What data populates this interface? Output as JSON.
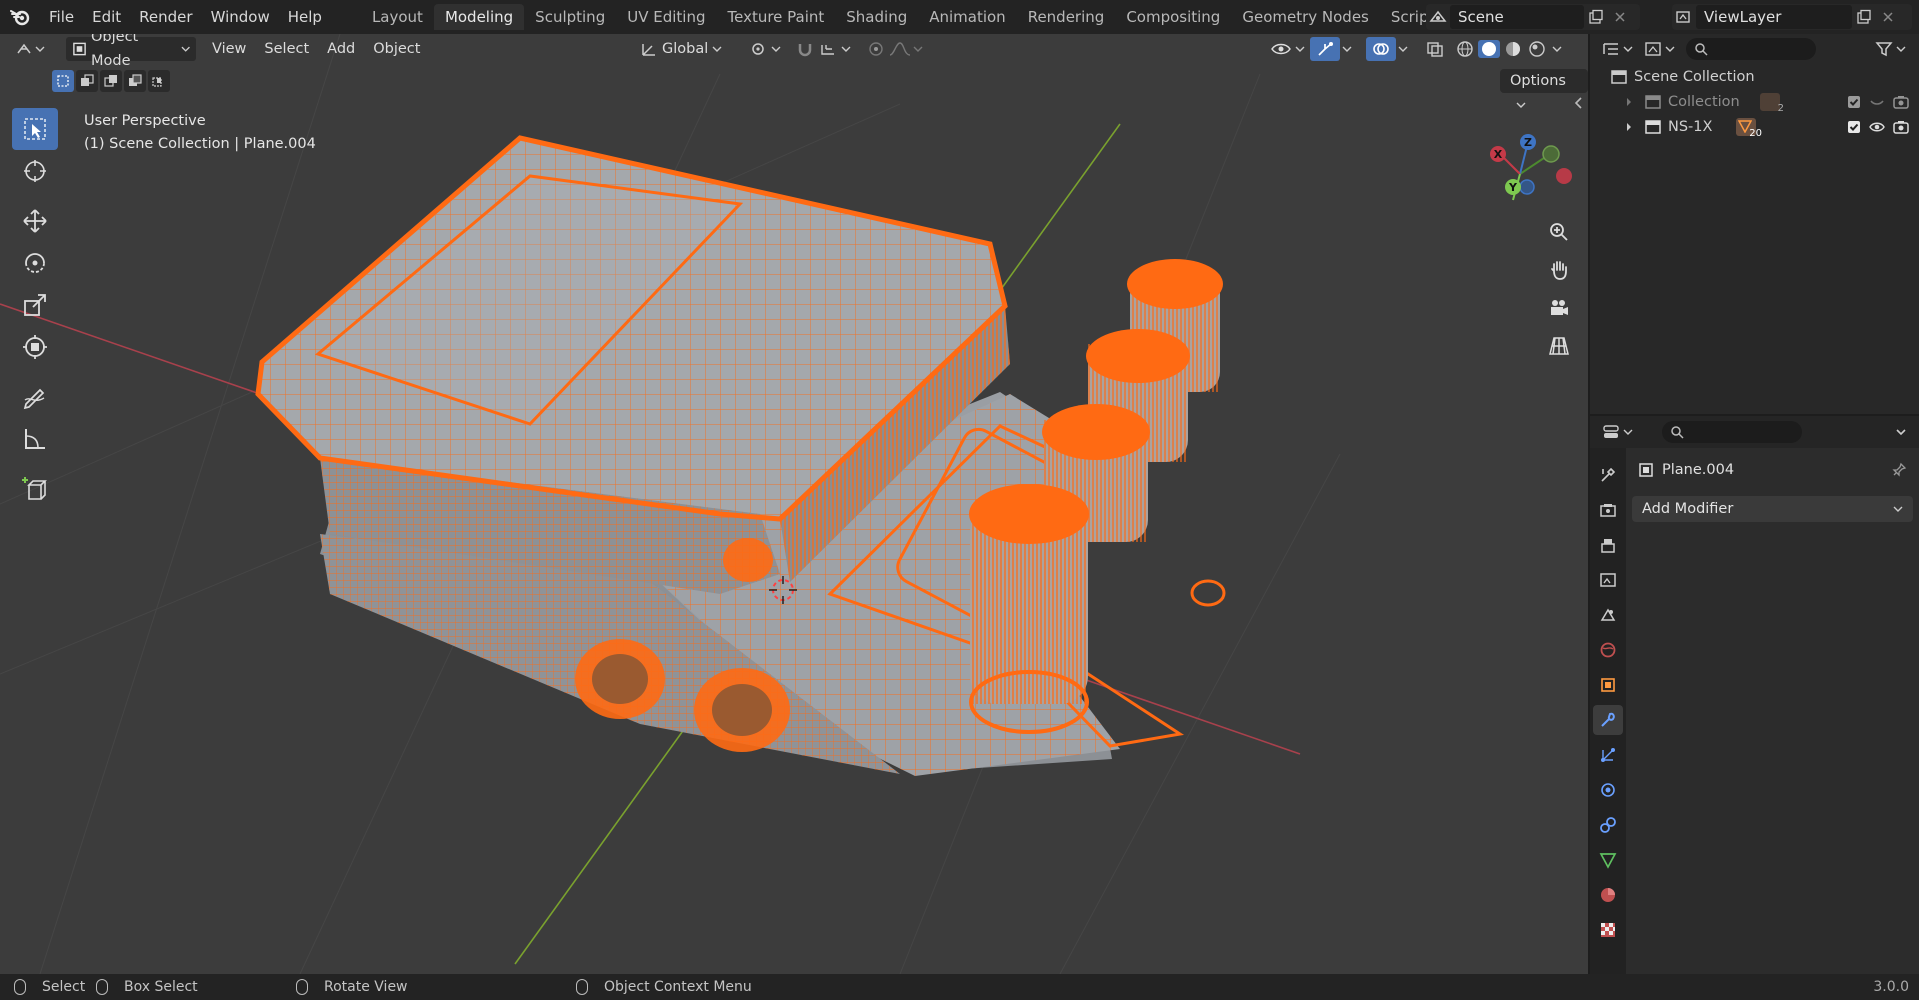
{
  "topbar": {
    "menus": [
      "File",
      "Edit",
      "Render",
      "Window",
      "Help"
    ],
    "workspaces": [
      "Layout",
      "Modeling",
      "Sculpting",
      "UV Editing",
      "Texture Paint",
      "Shading",
      "Animation",
      "Rendering",
      "Compositing",
      "Geometry Nodes",
      "Scripting"
    ],
    "active_workspace": "Modeling",
    "scene": "Scene",
    "view_layer": "ViewLayer"
  },
  "viewport": {
    "mode": "Object Mode",
    "menus": [
      "View",
      "Select",
      "Add",
      "Object"
    ],
    "transform_orientation": "Global",
    "options_label": "Options",
    "info_line1": "User Perspective",
    "info_line2": "(1) Scene Collection | Plane.004",
    "gizmo": {
      "x": "X",
      "y": "Y",
      "z": "Z"
    },
    "colors": {
      "background": "#3c3c3c",
      "wire": "#ff6a13",
      "mesh": "#9a9ea3",
      "x_axis": "#a8414c",
      "y_axis": "#7aa12e",
      "active_tool": "#4772b3"
    }
  },
  "outliner": {
    "root": "Scene Collection",
    "rows": [
      {
        "label": "Collection",
        "badge": "2",
        "dimmed": true
      },
      {
        "label": "NS-1X",
        "badge": "20",
        "dimmed": false
      }
    ]
  },
  "properties": {
    "object_name": "Plane.004",
    "add_modifier": "Add Modifier"
  },
  "statusbar": {
    "select": "Select",
    "box_select": "Box Select",
    "rotate_view": "Rotate View",
    "context_menu": "Object Context Menu",
    "version": "3.0.0"
  }
}
